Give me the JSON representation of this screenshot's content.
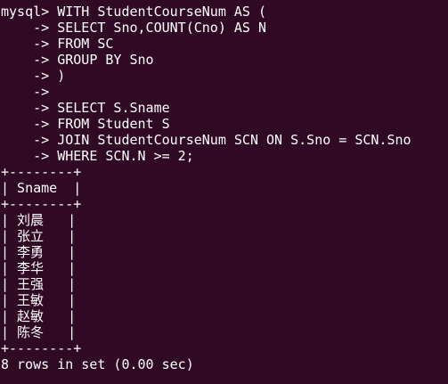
{
  "terminal": {
    "query_lines": [
      "mysql> WITH StudentCourseNum AS (",
      "    -> SELECT Sno,COUNT(Cno) AS N",
      "    -> FROM SC",
      "    -> GROUP BY Sno",
      "    -> )",
      "    ->",
      "    -> SELECT S.Sname",
      "    -> FROM Student S",
      "    -> JOIN StudentCourseNum SCN ON S.Sno = SCN.Sno",
      "    -> WHERE SCN.N >= 2;"
    ],
    "table_border": "+--------+",
    "table_header": "| Sname  |",
    "rows": [
      "| 刘晨   |",
      "| 张立   |",
      "| 李勇   |",
      "| 李华   |",
      "| 王强   |",
      "| 王敏   |",
      "| 赵敏   |",
      "| 陈冬   |"
    ],
    "summary": "8 rows in set (0.00 sec)"
  },
  "colors": {
    "background": "#300a24",
    "text": "#ffffff"
  }
}
